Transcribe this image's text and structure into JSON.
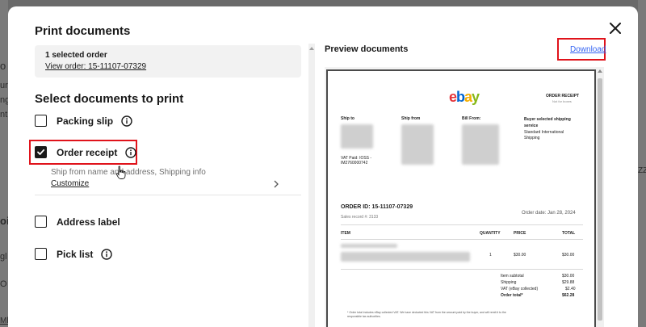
{
  "background_fragments": [
    "o",
    "ur",
    "ng",
    "nt",
    "oi",
    "gl",
    "O",
    "ZZ",
    "Mle"
  ],
  "dialog": {
    "title": "Print documents",
    "close_icon": "close-icon"
  },
  "order": {
    "count_text": "1 selected order",
    "view_link": "View order: 15-11107-07329"
  },
  "select": {
    "title": "Select documents to print",
    "options": [
      {
        "label": "Packing slip",
        "checked": false
      },
      {
        "label": "Order receipt",
        "checked": true,
        "description": "Ship from name and address, Shipping info",
        "customize": "Customize"
      },
      {
        "label": "Address label",
        "checked": false
      },
      {
        "label": "Pick list",
        "checked": false
      }
    ]
  },
  "preview": {
    "title": "Preview documents",
    "download": "Download"
  },
  "receipt": {
    "logo_letters": [
      "e",
      "b",
      "a",
      "y"
    ],
    "logo_colors": [
      "#e53238",
      "#0064d2",
      "#f5af02",
      "#86b817"
    ],
    "header_title": "ORDER RECEIPT",
    "header_sub": "Not for boxes",
    "ship_to_label": "Ship to",
    "ship_from_label": "Ship from",
    "bill_from_label": "Bill From:",
    "buyer_shipping_label": "Buyer selected shipping service",
    "shipping_service_line1": "Standard International",
    "shipping_service_line2": "Shipping",
    "vat_line1": "VAT Paid: IOSS -",
    "vat_line2": "IM2760000742",
    "order_id": "ORDER ID: 15-11107-07329",
    "sales_record": "Sales record #: 3133",
    "order_date": "Order date: Jan 28, 2024",
    "columns": {
      "item": "ITEM",
      "quantity": "QUANTITY",
      "price": "PRICE",
      "total": "TOTAL"
    },
    "row": {
      "quantity": "1",
      "price": "$30.00",
      "total": "$30.00"
    },
    "totals": [
      {
        "label": "Item subtotal",
        "value": "$30.00",
        "bold": false
      },
      {
        "label": "Shipping",
        "value": "$29.88",
        "bold": false
      },
      {
        "label": "VAT (eBay collected)",
        "value": "$2.40",
        "bold": false
      },
      {
        "label": "Order total*",
        "value": "$62.28",
        "bold": true
      }
    ],
    "footnote_line1": "* Order total includes eBay collected VAT. We have deducted this VAT from the amount paid by the buyer, and will remit it to the",
    "footnote_line2": "responsible tax authorities."
  }
}
